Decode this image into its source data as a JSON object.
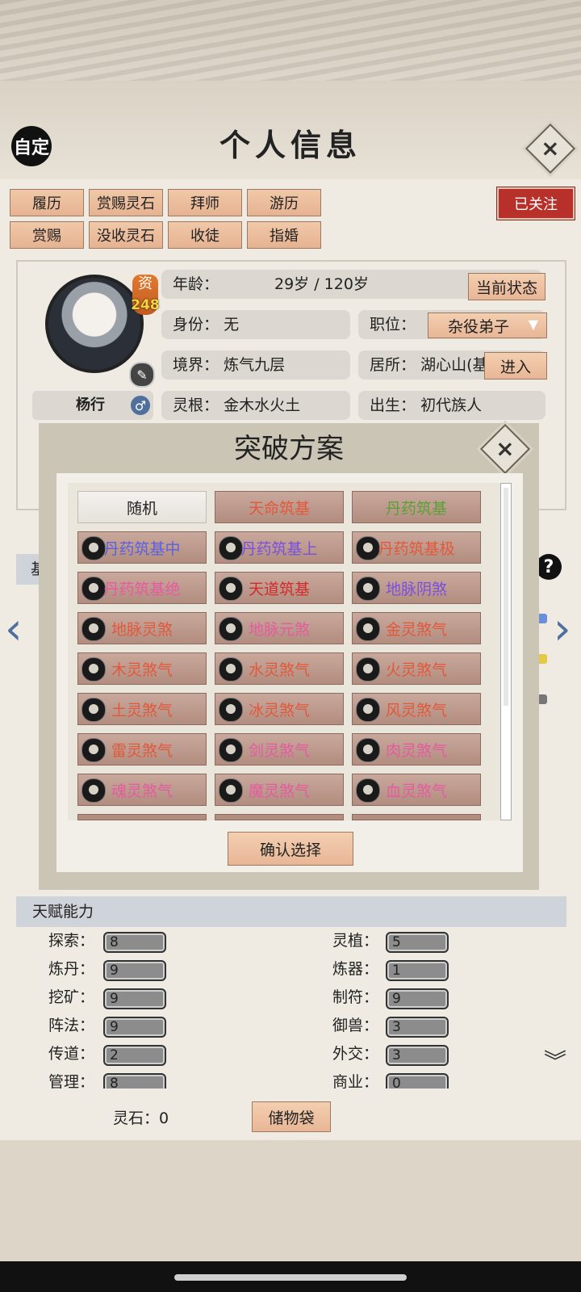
{
  "header": {
    "custom_label": "自定",
    "title": "个人信息",
    "close_icon": "close-icon"
  },
  "actions": {
    "row1": [
      "履历",
      "赏赐灵石",
      "拜师",
      "游历"
    ],
    "row2": [
      "赏赐",
      "没收灵石",
      "收徒",
      "指婚"
    ],
    "follow": "已关注"
  },
  "profile": {
    "aptitude_label": "资",
    "aptitude_value": "248",
    "name": "杨行",
    "age_label": "年龄：",
    "age_value": "29岁 / 120岁",
    "status_button": "当前状态",
    "identity_label": "身份：",
    "identity_value": "无",
    "position_label": "职位：",
    "position_value": "杂役弟子",
    "realm_label": "境界：",
    "realm_value": "炼气九层",
    "residence_label": "居所：",
    "residence_value": "湖心山(基",
    "enter_button": "进入",
    "root_label": "灵根：",
    "root_value": "金木水火土",
    "birth_label": "出生：",
    "birth_value": "初代族人",
    "tab_peek": "基"
  },
  "breakthrough": {
    "title": "突破方案",
    "options": [
      {
        "label": "随机",
        "color": "#222222"
      },
      {
        "label": "天命筑基",
        "color": "#e2583a"
      },
      {
        "label": "丹药筑基",
        "color": "#5aa033"
      },
      {
        "label": "丹药筑基中",
        "color": "#5b5fe0"
      },
      {
        "label": "丹药筑基上",
        "color": "#7a4fe0"
      },
      {
        "label": "丹药筑基极",
        "color": "#e2583a"
      },
      {
        "label": "丹药筑基绝",
        "color": "#e65aa0"
      },
      {
        "label": "天道筑基",
        "color": "#d42a2a"
      },
      {
        "label": "地脉阴煞",
        "color": "#7a4fe0"
      },
      {
        "label": "地脉灵煞",
        "color": "#e2583a"
      },
      {
        "label": "地脉元煞",
        "color": "#e65aa0"
      },
      {
        "label": "金灵煞气",
        "color": "#e2583a"
      },
      {
        "label": "木灵煞气",
        "color": "#e2583a"
      },
      {
        "label": "水灵煞气",
        "color": "#e2583a"
      },
      {
        "label": "火灵煞气",
        "color": "#e2583a"
      },
      {
        "label": "土灵煞气",
        "color": "#e2583a"
      },
      {
        "label": "冰灵煞气",
        "color": "#e2583a"
      },
      {
        "label": "风灵煞气",
        "color": "#e2583a"
      },
      {
        "label": "雷灵煞气",
        "color": "#e2583a"
      },
      {
        "label": "剑灵煞气",
        "color": "#e65aa0"
      },
      {
        "label": "肉灵煞气",
        "color": "#e65aa0"
      },
      {
        "label": "魂灵煞气",
        "color": "#e65aa0"
      },
      {
        "label": "魔灵煞气",
        "color": "#e65aa0"
      },
      {
        "label": "血灵煞气",
        "color": "#e65aa0"
      }
    ],
    "confirm": "确认选择"
  },
  "talents": {
    "title": "天赋能力",
    "left": [
      {
        "label": "探索：",
        "value": "8"
      },
      {
        "label": "炼丹：",
        "value": "9"
      },
      {
        "label": "挖矿：",
        "value": "9"
      },
      {
        "label": "阵法：",
        "value": "9"
      },
      {
        "label": "传道：",
        "value": "2"
      },
      {
        "label": "管理：",
        "value": "8"
      }
    ],
    "right": [
      {
        "label": "灵植：",
        "value": "5"
      },
      {
        "label": "炼器：",
        "value": "1"
      },
      {
        "label": "制符：",
        "value": "9"
      },
      {
        "label": "御兽：",
        "value": "3"
      },
      {
        "label": "外交：",
        "value": "3"
      },
      {
        "label": "商业：",
        "value": "0"
      }
    ]
  },
  "footer": {
    "stone": "灵石：0",
    "bag": "储物袋"
  },
  "colors": {
    "accent_blue": "#4f6f9c",
    "follow_red": "#b8302a",
    "button_peach": "#e6b392"
  }
}
